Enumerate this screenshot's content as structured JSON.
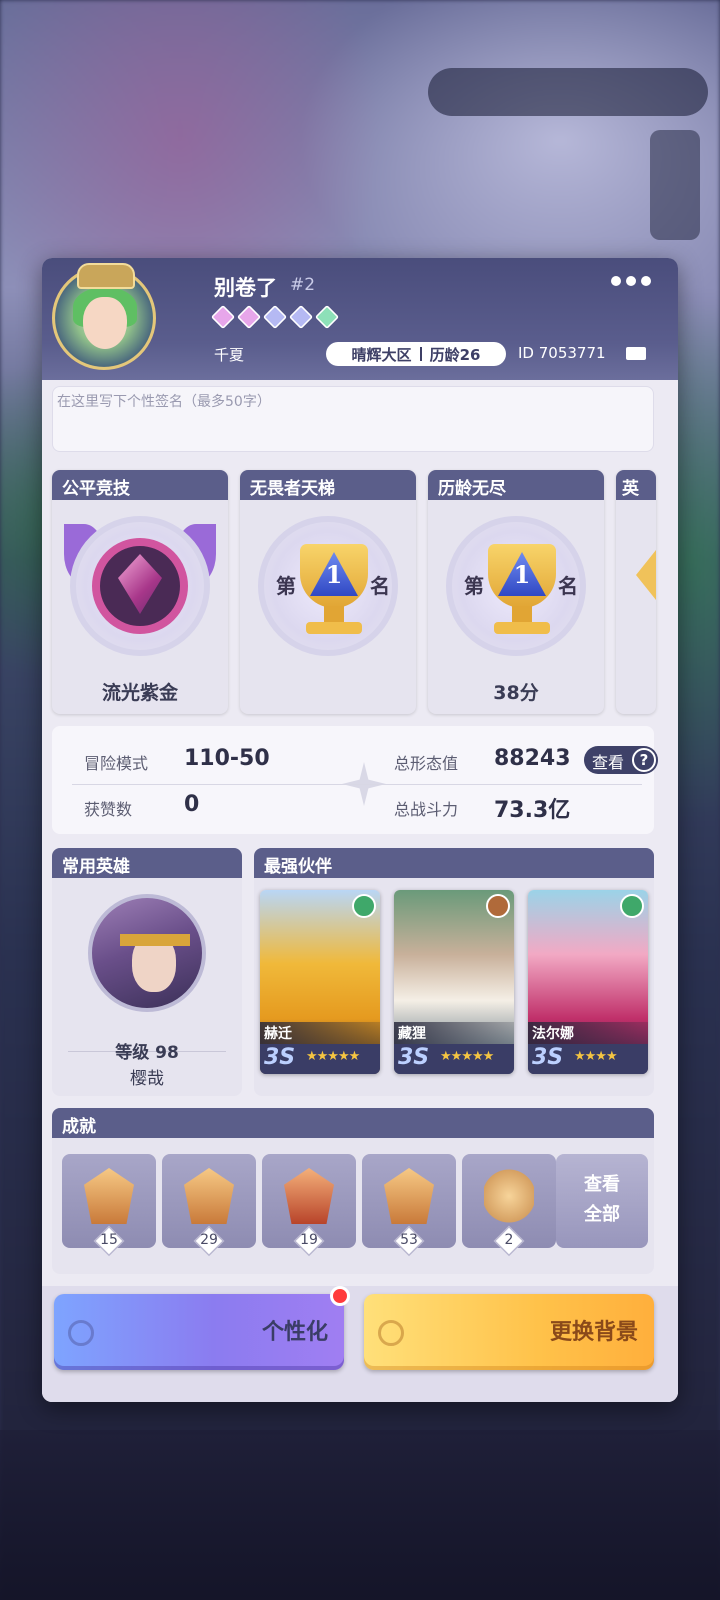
{
  "profile": {
    "name": "别卷了",
    "tag": "#2",
    "guild": "千夏",
    "region": "晴辉大区",
    "age": "历龄26",
    "id": "ID 7053771",
    "gem_colors": [
      "#e7a6ea",
      "#e7a6ea",
      "#b5b9f3",
      "#b5b9f3",
      "#8de0b8"
    ]
  },
  "signature": {
    "placeholder": "在这里写下个性签名（最多50字）"
  },
  "cards": [
    {
      "title": "公平竞技",
      "value": "流光紫金"
    },
    {
      "title": "无畏者天梯",
      "rank_num": "1",
      "rank_left": "第",
      "rank_right": "名",
      "value": ""
    },
    {
      "title": "历龄无尽",
      "rank_num": "1",
      "rank_left": "第",
      "rank_right": "名",
      "value": "38分"
    },
    {
      "title": "英"
    }
  ],
  "stats": {
    "adventure_label": "冒险模式",
    "adventure_value": "110-50",
    "likes_label": "获赞数",
    "likes_value": "0",
    "form_label": "总形态值",
    "form_value": "88243",
    "power_label": "总战斗力",
    "power_value": "73.3亿",
    "view_label": "查看",
    "help_icon": "?"
  },
  "common_hero": {
    "title": "常用英雄",
    "level": "等级 98",
    "name": "樱哉"
  },
  "partners": {
    "title": "最强伙伴",
    "items": [
      {
        "name": "赫迁",
        "grade": "3S",
        "stars": "★★★★★",
        "element_color": "#3fa86a"
      },
      {
        "name": "藏狸",
        "grade": "3S",
        "stars": "★★★★★",
        "element_color": "#b06a3a"
      },
      {
        "name": "法尔娜",
        "grade": "3S",
        "stars": "★★★★",
        "element_color": "#3fa86a"
      }
    ]
  },
  "achievements": {
    "title": "成就",
    "items": [
      {
        "count": "15"
      },
      {
        "count": "29"
      },
      {
        "count": "19"
      },
      {
        "count": "53"
      },
      {
        "count": "2"
      }
    ],
    "view_all_line1": "查看",
    "view_all_line2": "全部"
  },
  "buttons": {
    "personalize": "个性化",
    "change_background": "更换背景"
  }
}
